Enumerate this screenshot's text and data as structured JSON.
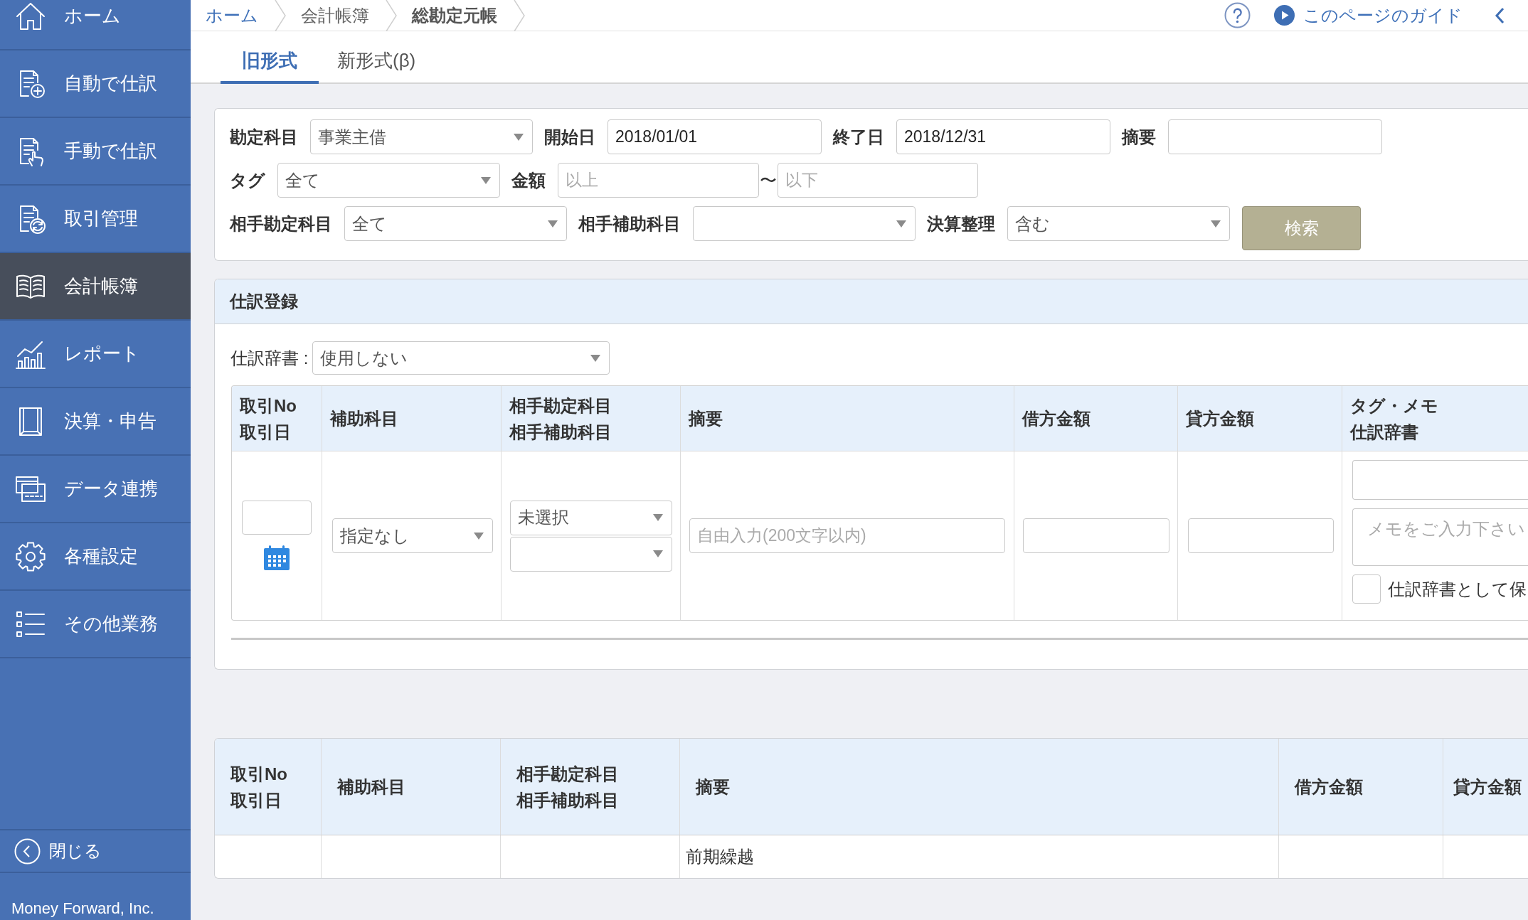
{
  "sidebar": {
    "items": [
      {
        "label": "ホーム",
        "selected": false
      },
      {
        "label": "自動で仕訳",
        "selected": false
      },
      {
        "label": "手動で仕訳",
        "selected": false
      },
      {
        "label": "取引管理",
        "selected": false
      },
      {
        "label": "会計帳簿",
        "selected": true
      },
      {
        "label": "レポート",
        "selected": false
      },
      {
        "label": "決算・申告",
        "selected": false
      },
      {
        "label": "データ連携",
        "selected": false
      },
      {
        "label": "各種設定",
        "selected": false
      },
      {
        "label": "その他業務",
        "selected": false
      }
    ],
    "close_label": "閉じる",
    "footer": "Money Forward, Inc."
  },
  "breadcrumbs": [
    {
      "label": "ホーム",
      "kind": "link"
    },
    {
      "label": "会計帳簿",
      "kind": "text"
    },
    {
      "label": "総勘定元帳",
      "kind": "current"
    }
  ],
  "guide_link": "このページのガイド",
  "tabs": [
    {
      "label": "旧形式",
      "selected": true
    },
    {
      "label": "新形式(β)",
      "selected": false
    }
  ],
  "filters": {
    "rows": [
      {
        "fields": [
          {
            "kind": "select",
            "label": "勘定科目",
            "value": "事業主借"
          },
          {
            "kind": "input",
            "label": "開始日",
            "value": "2018/01/01"
          },
          {
            "kind": "input",
            "label": "終了日",
            "value": "2018/12/31"
          },
          {
            "kind": "input",
            "label": "摘要"
          }
        ]
      },
      {
        "fields": [
          {
            "kind": "select",
            "label": "タグ",
            "value": "全て"
          },
          {
            "kind": "range",
            "label": "金額",
            "from_placeholder": "以上",
            "separator": "〜",
            "to_placeholder": "以下"
          }
        ]
      },
      {
        "fields": [
          {
            "kind": "select",
            "label": "相手勘定科目",
            "value": "全て"
          },
          {
            "kind": "select",
            "label": "相手補助科目"
          },
          {
            "kind": "select",
            "label": "決算整理",
            "value": "含む"
          },
          {
            "kind": "button",
            "label": "検索"
          }
        ]
      }
    ]
  },
  "entry": {
    "title": "仕訳登録",
    "dictionary": {
      "label": "仕訳辞書 :",
      "value": "使用しない"
    },
    "columns": [
      {
        "label": "取引No",
        "sublabel": "取引日"
      },
      {
        "label": "補助科目"
      },
      {
        "label": "相手勘定科目",
        "sublabel": "相手補助科目"
      },
      {
        "label": "摘要"
      },
      {
        "label": "借方金額"
      },
      {
        "label": "貸方金額"
      },
      {
        "label": "タグ・メモ",
        "sublabel": "仕訳辞書"
      }
    ],
    "cells": [
      {
        "controls": [
          {
            "kind": "input"
          },
          {
            "kind": "calendar"
          }
        ]
      },
      {
        "controls": [
          {
            "kind": "select",
            "value": "指定なし"
          }
        ]
      },
      {
        "controls": [
          {
            "kind": "select",
            "value": "未選択"
          },
          {
            "kind": "select"
          }
        ]
      },
      {
        "controls": [
          {
            "kind": "input",
            "placeholder": "自由入力(200文字以内)"
          }
        ]
      },
      {
        "controls": [
          {
            "kind": "input"
          }
        ]
      },
      {
        "controls": [
          {
            "kind": "input"
          }
        ]
      },
      {
        "controls": [
          {
            "kind": "input"
          },
          {
            "kind": "textarea",
            "placeholder": "メモをご入力下さい"
          },
          {
            "kind": "checkbox",
            "label": "仕訳辞書として保",
            "checked": false
          }
        ]
      }
    ]
  },
  "ledger": {
    "columns": [
      {
        "label": "取引No",
        "sublabel": "取引日"
      },
      {
        "label": "補助科目"
      },
      {
        "label": "相手勘定科目",
        "sublabel": "相手補助科目"
      },
      {
        "label": "摘要"
      },
      {
        "label": "借方金額"
      },
      {
        "label": "貸方金額"
      }
    ],
    "rows": [
      {
        "cells": [
          null,
          null,
          null,
          "前期繰越",
          null,
          null
        ]
      }
    ]
  }
}
